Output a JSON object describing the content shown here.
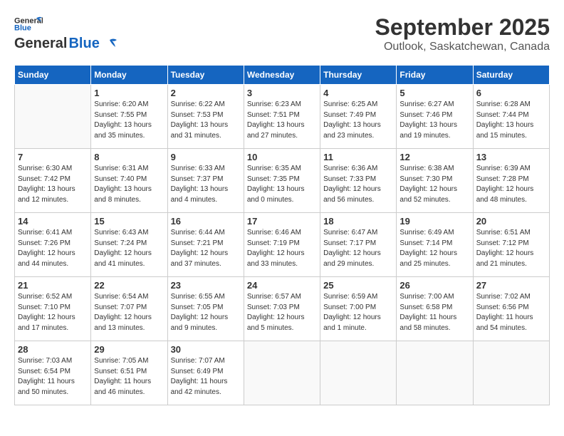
{
  "header": {
    "logo_general": "General",
    "logo_blue": "Blue",
    "month_year": "September 2025",
    "location": "Outlook, Saskatchewan, Canada"
  },
  "calendar": {
    "days_of_week": [
      "Sunday",
      "Monday",
      "Tuesday",
      "Wednesday",
      "Thursday",
      "Friday",
      "Saturday"
    ],
    "weeks": [
      [
        {
          "day": "",
          "content": ""
        },
        {
          "day": "1",
          "content": "Sunrise: 6:20 AM\nSunset: 7:55 PM\nDaylight: 13 hours\nand 35 minutes."
        },
        {
          "day": "2",
          "content": "Sunrise: 6:22 AM\nSunset: 7:53 PM\nDaylight: 13 hours\nand 31 minutes."
        },
        {
          "day": "3",
          "content": "Sunrise: 6:23 AM\nSunset: 7:51 PM\nDaylight: 13 hours\nand 27 minutes."
        },
        {
          "day": "4",
          "content": "Sunrise: 6:25 AM\nSunset: 7:49 PM\nDaylight: 13 hours\nand 23 minutes."
        },
        {
          "day": "5",
          "content": "Sunrise: 6:27 AM\nSunset: 7:46 PM\nDaylight: 13 hours\nand 19 minutes."
        },
        {
          "day": "6",
          "content": "Sunrise: 6:28 AM\nSunset: 7:44 PM\nDaylight: 13 hours\nand 15 minutes."
        }
      ],
      [
        {
          "day": "7",
          "content": "Sunrise: 6:30 AM\nSunset: 7:42 PM\nDaylight: 13 hours\nand 12 minutes."
        },
        {
          "day": "8",
          "content": "Sunrise: 6:31 AM\nSunset: 7:40 PM\nDaylight: 13 hours\nand 8 minutes."
        },
        {
          "day": "9",
          "content": "Sunrise: 6:33 AM\nSunset: 7:37 PM\nDaylight: 13 hours\nand 4 minutes."
        },
        {
          "day": "10",
          "content": "Sunrise: 6:35 AM\nSunset: 7:35 PM\nDaylight: 13 hours\nand 0 minutes."
        },
        {
          "day": "11",
          "content": "Sunrise: 6:36 AM\nSunset: 7:33 PM\nDaylight: 12 hours\nand 56 minutes."
        },
        {
          "day": "12",
          "content": "Sunrise: 6:38 AM\nSunset: 7:30 PM\nDaylight: 12 hours\nand 52 minutes."
        },
        {
          "day": "13",
          "content": "Sunrise: 6:39 AM\nSunset: 7:28 PM\nDaylight: 12 hours\nand 48 minutes."
        }
      ],
      [
        {
          "day": "14",
          "content": "Sunrise: 6:41 AM\nSunset: 7:26 PM\nDaylight: 12 hours\nand 44 minutes."
        },
        {
          "day": "15",
          "content": "Sunrise: 6:43 AM\nSunset: 7:24 PM\nDaylight: 12 hours\nand 41 minutes."
        },
        {
          "day": "16",
          "content": "Sunrise: 6:44 AM\nSunset: 7:21 PM\nDaylight: 12 hours\nand 37 minutes."
        },
        {
          "day": "17",
          "content": "Sunrise: 6:46 AM\nSunset: 7:19 PM\nDaylight: 12 hours\nand 33 minutes."
        },
        {
          "day": "18",
          "content": "Sunrise: 6:47 AM\nSunset: 7:17 PM\nDaylight: 12 hours\nand 29 minutes."
        },
        {
          "day": "19",
          "content": "Sunrise: 6:49 AM\nSunset: 7:14 PM\nDaylight: 12 hours\nand 25 minutes."
        },
        {
          "day": "20",
          "content": "Sunrise: 6:51 AM\nSunset: 7:12 PM\nDaylight: 12 hours\nand 21 minutes."
        }
      ],
      [
        {
          "day": "21",
          "content": "Sunrise: 6:52 AM\nSunset: 7:10 PM\nDaylight: 12 hours\nand 17 minutes."
        },
        {
          "day": "22",
          "content": "Sunrise: 6:54 AM\nSunset: 7:07 PM\nDaylight: 12 hours\nand 13 minutes."
        },
        {
          "day": "23",
          "content": "Sunrise: 6:55 AM\nSunset: 7:05 PM\nDaylight: 12 hours\nand 9 minutes."
        },
        {
          "day": "24",
          "content": "Sunrise: 6:57 AM\nSunset: 7:03 PM\nDaylight: 12 hours\nand 5 minutes."
        },
        {
          "day": "25",
          "content": "Sunrise: 6:59 AM\nSunset: 7:00 PM\nDaylight: 12 hours\nand 1 minute."
        },
        {
          "day": "26",
          "content": "Sunrise: 7:00 AM\nSunset: 6:58 PM\nDaylight: 11 hours\nand 58 minutes."
        },
        {
          "day": "27",
          "content": "Sunrise: 7:02 AM\nSunset: 6:56 PM\nDaylight: 11 hours\nand 54 minutes."
        }
      ],
      [
        {
          "day": "28",
          "content": "Sunrise: 7:03 AM\nSunset: 6:54 PM\nDaylight: 11 hours\nand 50 minutes."
        },
        {
          "day": "29",
          "content": "Sunrise: 7:05 AM\nSunset: 6:51 PM\nDaylight: 11 hours\nand 46 minutes."
        },
        {
          "day": "30",
          "content": "Sunrise: 7:07 AM\nSunset: 6:49 PM\nDaylight: 11 hours\nand 42 minutes."
        },
        {
          "day": "",
          "content": ""
        },
        {
          "day": "",
          "content": ""
        },
        {
          "day": "",
          "content": ""
        },
        {
          "day": "",
          "content": ""
        }
      ]
    ]
  }
}
